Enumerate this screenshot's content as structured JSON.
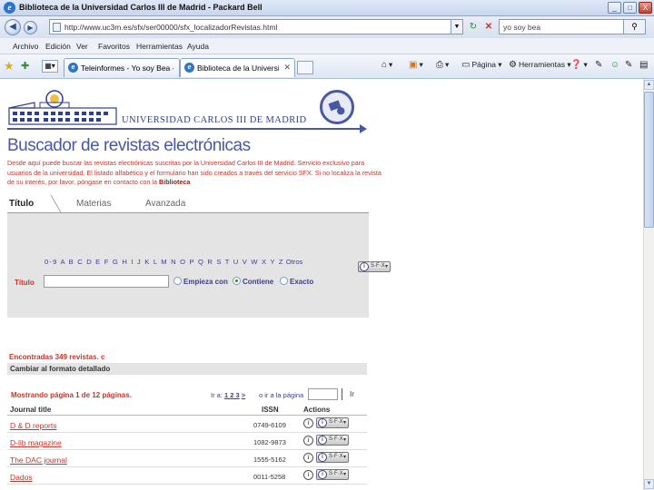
{
  "window": {
    "title": "Biblioteca de la Universidad Carlos III de Madrid - Packard Bell",
    "minimize_label": "_",
    "maximize_label": "□",
    "close_label": "X"
  },
  "address": {
    "url": "http://www.uc3m.es/sfx/ser00000/sfx_localizadorRevistas.html",
    "search_value": "yo soy bea"
  },
  "menu": {
    "items": [
      "Archivo",
      "Edición",
      "Ver",
      "Favoritos",
      "Herramientas",
      "Ayuda"
    ]
  },
  "tabs": [
    {
      "label": "Teleinformes - Yo soy Bea - Y..."
    },
    {
      "label": "Biblioteca de la Universid..."
    }
  ],
  "commands": {
    "pagina": "Página",
    "herramientas": "Herramientas"
  },
  "header": {
    "university_name": "UNIVERSIDAD CARLOS III DE MADRID",
    "page_title": "Buscador de revistas electrónicas",
    "intro": "Desde aquí puede buscar las revistas electrónicas suscritas por la Universidad Carlos III de Madrid. Servicio exclusivo para usuarios de la universidad. El listado alfabético y el formulario han sido creados a través del servicio SFX. Si no localiza la revista de su interés, por favor, póngase en contacto con la",
    "intro_link": "Biblioteca"
  },
  "search_tabs": [
    "Título",
    "Materias",
    "Avanzada"
  ],
  "search": {
    "alphabet": "0-9 A B C D E F G H I J K L M N O P Q R S T U V W X Y Z",
    "otros": "Otros",
    "title_label": "Título",
    "title_value": "",
    "options": [
      {
        "label": "Empieza con",
        "checked": false
      },
      {
        "label": "Contiene",
        "checked": true
      },
      {
        "label": "Exacto",
        "checked": false
      }
    ]
  },
  "sfx_button": {
    "label": "S·F·X",
    "arrow": "▾"
  },
  "results": {
    "found": "Encontradas 349 revistas. c",
    "change_format": "Cambiar al formato detallado",
    "page_info": "Mostrando página 1 de 12 páginas.",
    "ira": "Ir a:",
    "pages": "1 2 3",
    "next": ">",
    "goto_label": "o ir a la página",
    "goto_button": "Ir",
    "columns": [
      "Journal title",
      "ISSN",
      "Actions"
    ],
    "rows": [
      {
        "title": "D & D reports",
        "issn": "0749-6109"
      },
      {
        "title": "D-lib magazine",
        "issn": "1082-9873"
      },
      {
        "title": "The DAC journal",
        "issn": "1555-5162"
      },
      {
        "title": "Dados",
        "issn": "0011-5258"
      }
    ]
  },
  "icons": {
    "ie_logo": "e",
    "info": "i"
  }
}
